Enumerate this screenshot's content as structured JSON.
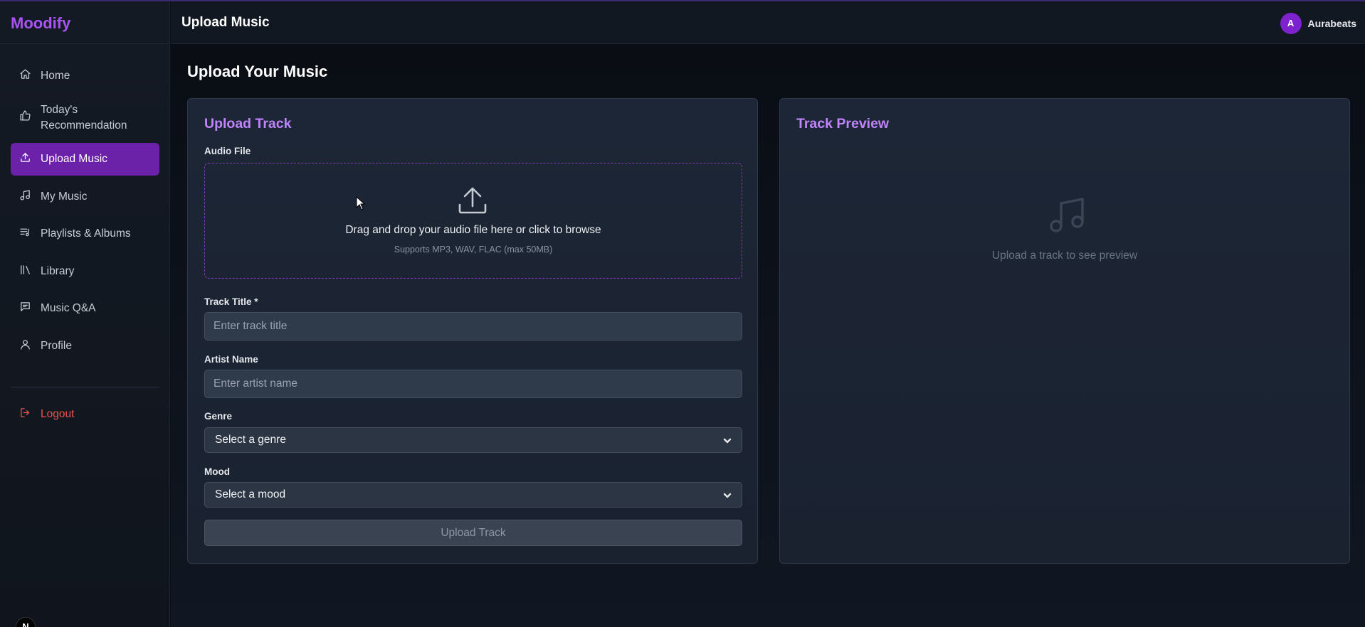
{
  "brand": {
    "name": "Moodify",
    "color": "#a855f7"
  },
  "sidebar": {
    "items": [
      {
        "label": "Home",
        "icon": "home-icon",
        "active": false
      },
      {
        "label": "Today's Recommendation",
        "icon": "thumbs-up-icon",
        "active": false
      },
      {
        "label": "Upload Music",
        "icon": "upload-icon",
        "active": true
      },
      {
        "label": "My Music",
        "icon": "music-note-icon",
        "active": false
      },
      {
        "label": "Playlists & Albums",
        "icon": "playlist-icon",
        "active": false
      },
      {
        "label": "Library",
        "icon": "library-icon",
        "active": false
      },
      {
        "label": "Music Q&A",
        "icon": "chat-icon",
        "active": false
      },
      {
        "label": "Profile",
        "icon": "user-icon",
        "active": false
      }
    ],
    "logout_label": "Logout"
  },
  "header": {
    "title": "Upload Music",
    "user": {
      "initial": "A",
      "name": "Aurabeats"
    }
  },
  "main": {
    "page_title": "Upload Your Music",
    "upload_card": {
      "title": "Upload Track",
      "audio_label": "Audio File",
      "dropzone_text": "Drag and drop your audio file here or click to browse",
      "dropzone_hint": "Supports MP3, WAV, FLAC (max 50MB)",
      "track_title_label": "Track Title *",
      "track_title_placeholder": "Enter track title",
      "track_title_value": "",
      "artist_label": "Artist Name",
      "artist_placeholder": "Enter artist name",
      "artist_value": "",
      "genre_label": "Genre",
      "genre_selected": "Select a genre",
      "mood_label": "Mood",
      "mood_selected": "Select a mood",
      "submit_label": "Upload Track"
    },
    "preview_card": {
      "title": "Track Preview",
      "empty_text": "Upload a track to see preview"
    }
  },
  "colors": {
    "accent": "#6b21a8",
    "accent_text": "#c084fc",
    "logout": "#f05252"
  },
  "framework_badge": "N"
}
